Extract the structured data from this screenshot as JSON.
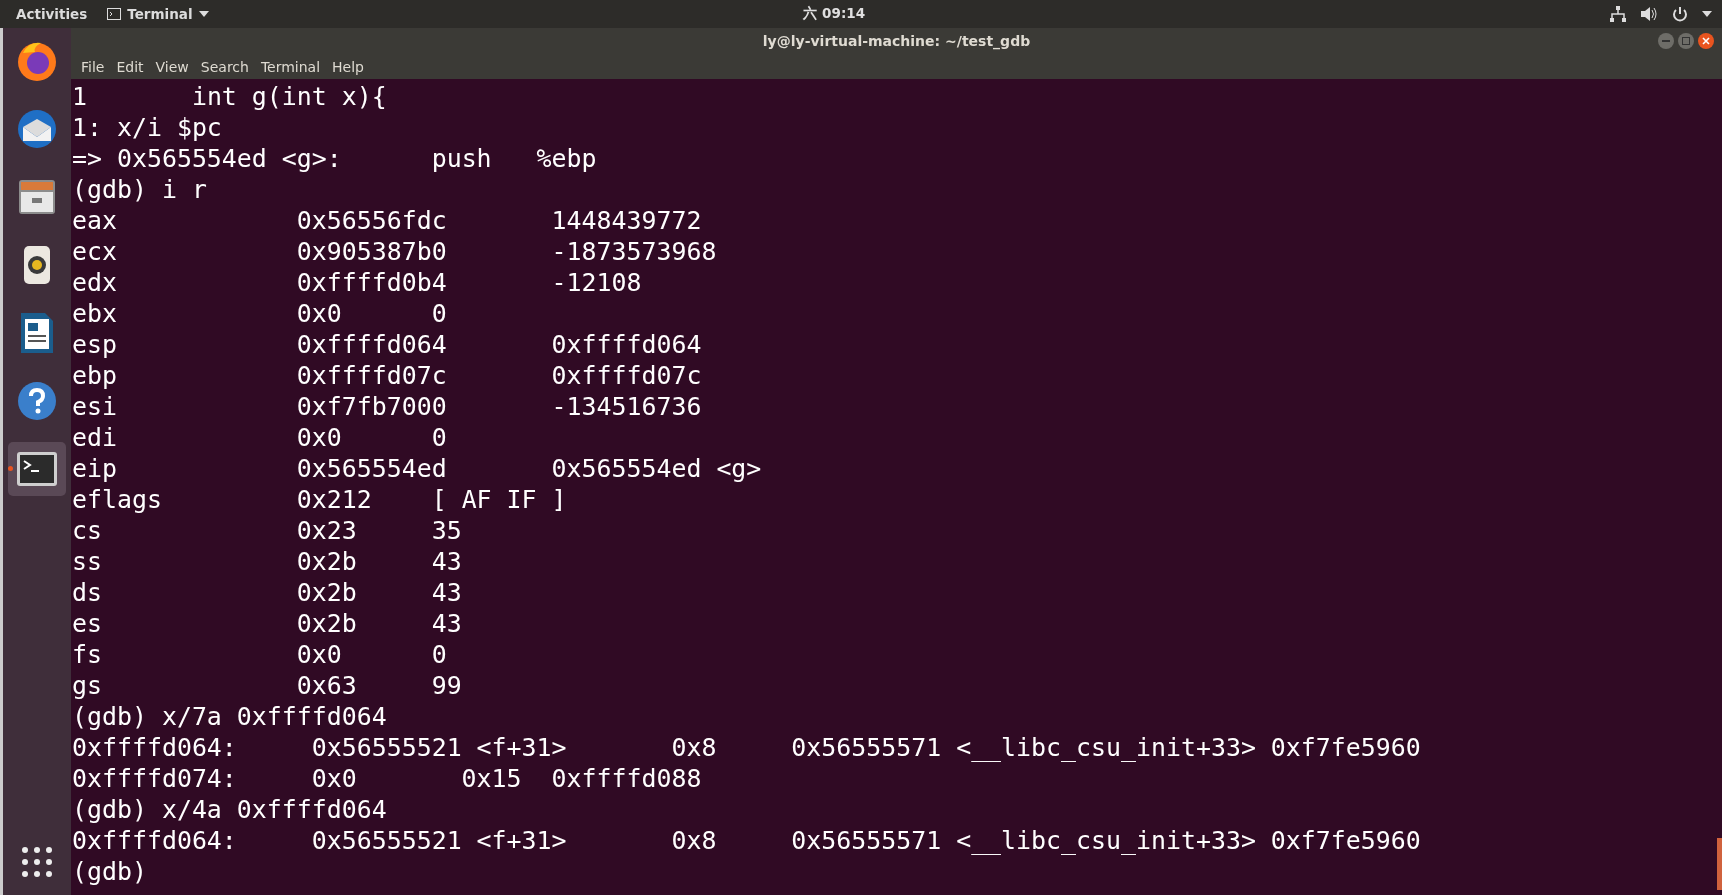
{
  "top_bar": {
    "activities": "Activities",
    "app_menu": "Terminal",
    "clock": "六 09:14"
  },
  "dock": {
    "items": [
      {
        "kind": "browser",
        "running": false
      },
      {
        "kind": "mail",
        "running": false
      },
      {
        "kind": "files",
        "running": false
      },
      {
        "kind": "music",
        "running": false
      },
      {
        "kind": "document",
        "running": false
      },
      {
        "kind": "help",
        "running": false
      },
      {
        "kind": "terminal",
        "running": true
      }
    ]
  },
  "window": {
    "title": "ly@ly-virtual-machine: ~/test_gdb",
    "menu": [
      "File",
      "Edit",
      "View",
      "Search",
      "Terminal",
      "Help"
    ]
  },
  "terminal": {
    "lines": [
      "1\tint g(int x){",
      "1: x/i $pc",
      "=> 0x565554ed <g>:\tpush   %ebp",
      "(gdb) i r",
      "eax            0x56556fdc\t1448439772",
      "ecx            0x905387b0\t-1873573968",
      "edx            0xffffd0b4\t-12108",
      "ebx            0x0\t0",
      "esp            0xffffd064\t0xffffd064",
      "ebp            0xffffd07c\t0xffffd07c",
      "esi            0xf7fb7000\t-134516736",
      "edi            0x0\t0",
      "eip            0x565554ed\t0x565554ed <g>",
      "eflags         0x212\t[ AF IF ]",
      "cs             0x23\t35",
      "ss             0x2b\t43",
      "ds             0x2b\t43",
      "es             0x2b\t43",
      "fs             0x0\t0",
      "gs             0x63\t99",
      "(gdb) x/7a 0xffffd064",
      "0xffffd064:\t0x56555521 <f+31>\t0x8\t0x56555571 <__libc_csu_init+33>\t0xf7fe5960",
      "0xffffd074:     0x0       0x15  0xffffd088",
      "(gdb) x/4a 0xffffd064",
      "0xffffd064:\t0x56555521 <f+31>\t0x8\t0x56555571 <__libc_csu_init+33>\t0xf7fe5960",
      "(gdb) "
    ]
  }
}
